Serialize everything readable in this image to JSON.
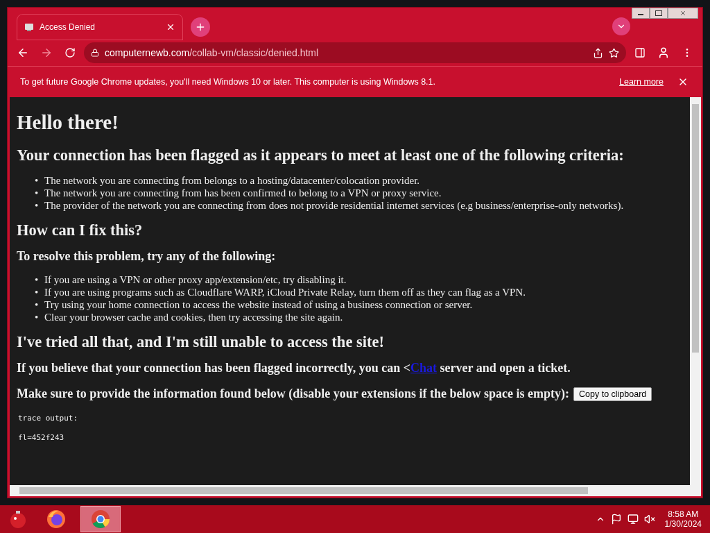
{
  "browser": {
    "tab": {
      "title": "Access Denied",
      "selected": true
    },
    "url": {
      "host": "computernewb.com",
      "path": "/collab-vm/classic/denied.html"
    },
    "forward_disabled": true
  },
  "infobar": {
    "message": "To get future Google Chrome updates, you'll need Windows 10 or later. This computer is using Windows 8.1.",
    "link": "Learn more"
  },
  "page": {
    "title": "Hello there!",
    "heading": "Your connection has been flagged as it appears to meet at least one of the following criteria:",
    "criteria": [
      {
        "marker": "•",
        "text": "The network you are connecting from belongs to a hosting/datacenter/colocation provider."
      },
      {
        "marker": "•",
        "text": "The network you are connecting from has been confirmed to belong to a VPN or proxy service."
      },
      {
        "marker": "•",
        "text": "The provider of the network you are connecting from does not provide residential internet services (e.g business/enterprise-only networks)."
      }
    ],
    "fix_heading": "How can I fix this?",
    "fix_intro": "To resolve this problem, try any of the following:",
    "fixes": [
      {
        "marker": "•",
        "text": "If you are using a VPN or other proxy app/extension/etc, try disabling it."
      },
      {
        "marker": "•",
        "text": "If you are using programs such as Cloudflare WARP, iCloud Private Relay, turn them off as they can flag as a VPN."
      },
      {
        "marker": "•",
        "text": "Try using your home connection to access the website instead of using a business connection or server."
      },
      {
        "marker": "•",
        "text": "Clear your browser cache and cookies, then try accessing the site again."
      }
    ],
    "tried_heading": "I've tried all that, and I'm still unable to access the site!",
    "ticket": {
      "before": "If you believe that your connection has been flagged incorrectly, you can <",
      "link": "Chat",
      "after": " server and open a ticket."
    },
    "provide": "Make sure to provide the information found below (disable your extensions if the below space is empty):",
    "copy_button": "Copy to clipboard",
    "trace": [
      "trace output:",
      "fl=452f243"
    ]
  },
  "taskbar": {
    "apps": [
      {
        "kind": "firefox",
        "selected": false
      },
      {
        "kind": "chrome",
        "selected": true
      }
    ],
    "time": "8:58 AM",
    "date": "1/30/2024"
  }
}
